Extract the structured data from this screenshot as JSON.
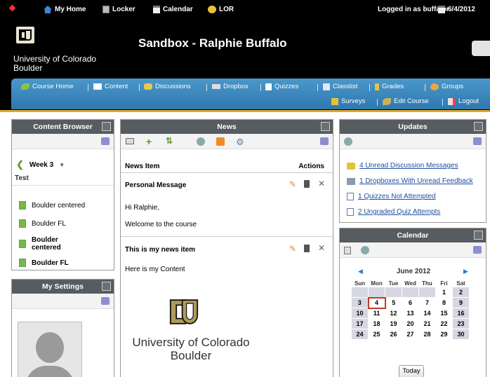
{
  "topbar": {
    "home": "My Home",
    "locker": "Locker",
    "calendar": "Calendar",
    "lor": "LOR",
    "logged_in": "Logged in as buffalor",
    "date": "6/4/2012"
  },
  "header": {
    "university": "University of Colorado",
    "campus": "Boulder",
    "course_title": "Sandbox - Ralphie Buffalo"
  },
  "nav": {
    "items": [
      "Course Home",
      "Content",
      "Discussions",
      "Dropbox",
      "Quizzes",
      "Classlist",
      "Grades",
      "Groups"
    ],
    "items2": [
      "Surveys",
      "Edit Course",
      "Logout"
    ]
  },
  "content_browser": {
    "title": "Content Browser",
    "week": "Week 3",
    "module": "Test",
    "items": [
      "Boulder centered",
      "Boulder FL",
      "Boulder centered",
      "Boulder FL"
    ]
  },
  "my_settings": {
    "title": "My Settings"
  },
  "news": {
    "title": "News",
    "col_item": "News Item",
    "col_actions": "Actions",
    "items": [
      {
        "title": "Personal Message",
        "lines": [
          "Hi Ralphie,",
          "Welcome to the course"
        ]
      },
      {
        "title": "This is my news item",
        "lines": [
          "Here is my Content"
        ]
      }
    ],
    "logo_line1": "University of Colorado",
    "logo_line2": "Boulder"
  },
  "updates": {
    "title": "Updates",
    "items": [
      "4 Unread Discussion Messages",
      "1 Dropboxes With Unread Feedback",
      "1 Quizzes Not Attempted",
      "2 Ungraded Quiz Attempts"
    ]
  },
  "calendar": {
    "title": "Calendar",
    "month": "June 2012",
    "days": [
      "Sun",
      "Mon",
      "Tue",
      "Wed",
      "Thu",
      "Fri",
      "Sat"
    ],
    "weeks": [
      [
        "",
        "",
        "",
        "",
        "",
        "1",
        "2"
      ],
      [
        "3",
        "4",
        "5",
        "6",
        "7",
        "8",
        "9"
      ],
      [
        "10",
        "11",
        "12",
        "13",
        "14",
        "15",
        "16"
      ],
      [
        "17",
        "18",
        "19",
        "20",
        "21",
        "22",
        "23"
      ],
      [
        "24",
        "25",
        "26",
        "27",
        "28",
        "29",
        "30"
      ]
    ],
    "today_label": "Today"
  }
}
